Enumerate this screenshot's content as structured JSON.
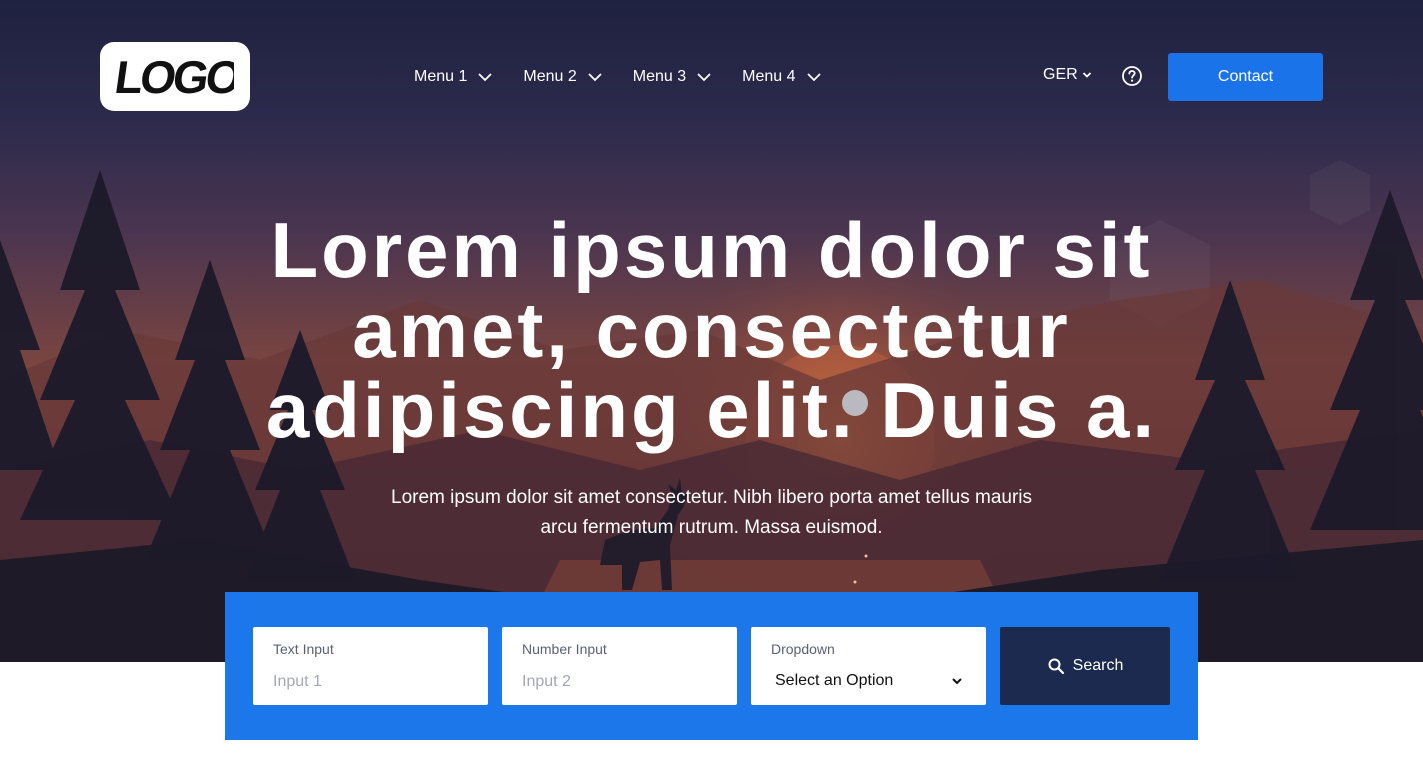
{
  "header": {
    "logo_text": "LOGO",
    "nav": [
      {
        "label": "Menu 1",
        "icon": "chevron-down-icon"
      },
      {
        "label": "Menu 2",
        "icon": "chevron-down-icon"
      },
      {
        "label": "Menu 3",
        "icon": "chevron-down-icon"
      },
      {
        "label": "Menu 4",
        "icon": "chevron-down-icon"
      }
    ],
    "language": "GER",
    "help_icon": "help-circle-icon",
    "contact_label": "Contact"
  },
  "hero": {
    "headline": "Lorem ipsum dolor sit amet, consectetur adipiscing elit. Duis a.",
    "subline": "Lorem ipsum dolor sit amet consectetur. Nibh libero porta amet tellus mauris arcu fermentum rutrum. Massa euismod."
  },
  "search": {
    "text_input": {
      "label": "Text Input",
      "placeholder": "Input 1",
      "value": ""
    },
    "number_input": {
      "label": "Number Input",
      "placeholder": "Input 2",
      "value": ""
    },
    "dropdown": {
      "label": "Dropdown",
      "selected": "Select an Option"
    },
    "button_label": "Search",
    "button_icon": "search-icon"
  },
  "colors": {
    "accent": "#1c77eb",
    "contact_button": "#1a73e8",
    "search_button": "#1b2a4e",
    "text_light": "#ffffff"
  }
}
